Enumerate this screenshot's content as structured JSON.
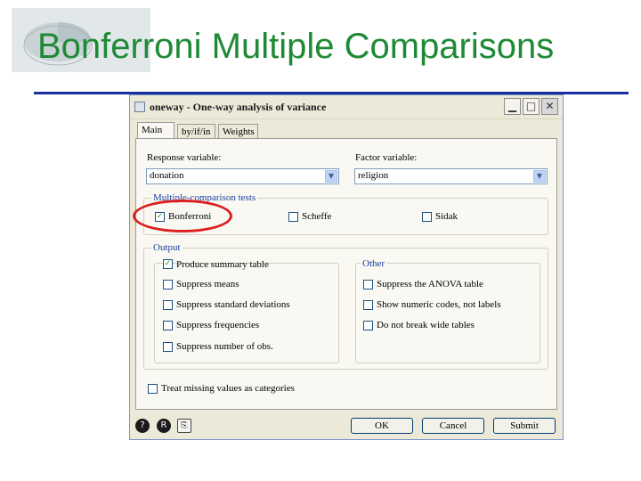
{
  "slide": {
    "title": "Bonferroni Multiple Comparisons"
  },
  "dialog": {
    "title": "oneway - One-way analysis of variance",
    "tabs": [
      {
        "label": "Main",
        "active": true
      },
      {
        "label": "by/if/in",
        "active": false
      },
      {
        "label": "Weights",
        "active": false
      }
    ],
    "response": {
      "label": "Response variable:",
      "value": "donation"
    },
    "factor": {
      "label": "Factor variable:",
      "value": "religion"
    },
    "multiple_tests": {
      "label": "Multiple-comparison tests",
      "options": [
        {
          "label": "Bonferroni",
          "checked": true
        },
        {
          "label": "Scheffe",
          "checked": false
        },
        {
          "label": "Sidak",
          "checked": false
        }
      ]
    },
    "output": {
      "label": "Output",
      "options": [
        {
          "label": "Produce summary table",
          "checked": true
        },
        {
          "label": "Suppress means",
          "checked": false
        },
        {
          "label": "Suppress standard deviations",
          "checked": false
        },
        {
          "label": "Suppress frequencies",
          "checked": false
        },
        {
          "label": "Suppress number of obs.",
          "checked": false
        }
      ]
    },
    "other": {
      "label": "Other",
      "options": [
        {
          "label": "Suppress the ANOVA table",
          "checked": false
        },
        {
          "label": "Show numeric codes, not labels",
          "checked": false
        },
        {
          "label": "Do not break wide tables",
          "checked": false
        }
      ]
    },
    "missing": {
      "label": "Treat missing values as categories",
      "checked": false
    },
    "buttons": {
      "ok": "OK",
      "cancel": "Cancel",
      "submit": "Submit"
    },
    "colors": {
      "highlight": "#dd1f1f",
      "group_label": "#1a3fa0",
      "title_green": "#1f8a36",
      "rule_blue": "#1b2fa0"
    },
    "icons": [
      "help-icon",
      "reset-icon",
      "copy-icon"
    ]
  }
}
